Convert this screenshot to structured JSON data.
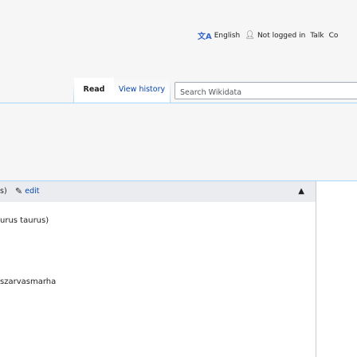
{
  "personal_tools": {
    "language": "English",
    "login_status": "Not logged in",
    "talk": "Talk",
    "cut_item": "Co"
  },
  "views": {
    "read": "Read",
    "history": "View history"
  },
  "search": {
    "placeholder": "Search Wikidata"
  },
  "statement": {
    "cut_prefix": "s)",
    "edit": "edit",
    "value": "urus taurus)",
    "other_label": "szarvasmarha"
  },
  "colors": {
    "link": "#0645ad",
    "tab_border": "#a7d7f9",
    "header_bg": "#eaecf0"
  },
  "icons": [
    "language-icon",
    "user-icon",
    "pencil-icon",
    "chevron-up-icon"
  ]
}
